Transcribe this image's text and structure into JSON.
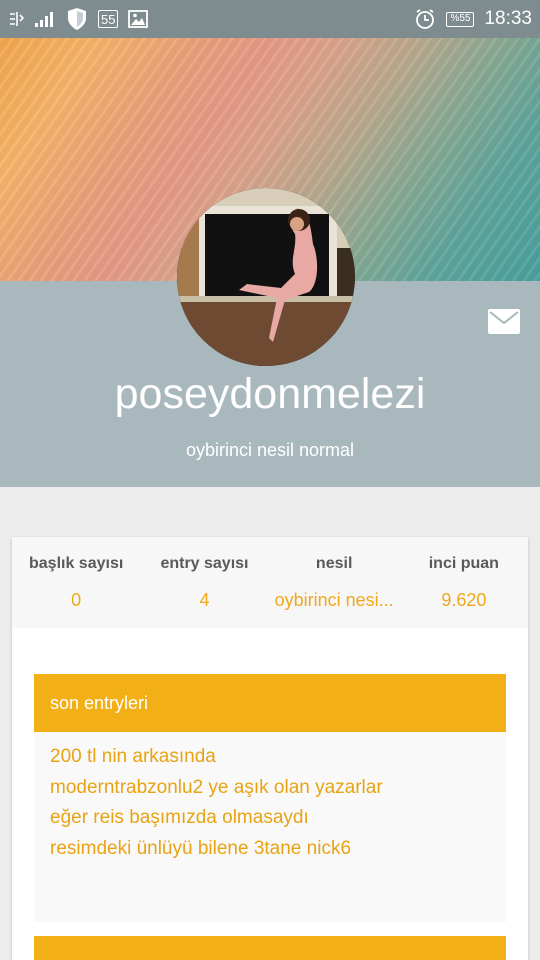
{
  "status_bar": {
    "left_icons": [
      "usb-debug-icon",
      "signal-icon",
      "shield-icon",
      "notification-count-icon",
      "image-icon"
    ],
    "notification_count": "55",
    "battery_label": "%55",
    "time": "18:33"
  },
  "profile": {
    "username": "poseydonmelezi",
    "subtitle": "oybirinci nesil normal"
  },
  "stats": [
    {
      "label": "başlık sayısı",
      "value": "0"
    },
    {
      "label": "entry sayısı",
      "value": "4"
    },
    {
      "label": "nesil",
      "value": "oybirinci nesi..."
    },
    {
      "label": "inci puan",
      "value": "9.620"
    }
  ],
  "sections": {
    "recent_entries": {
      "title": "son entryleri",
      "items": [
        "200 tl nin arkasında",
        "moderntrabzonlu2 ye aşık olan yazarlar",
        "eğer reis başımızda olmasaydı",
        "resimdeki ünlüyü bilene 3tane nick6"
      ]
    }
  },
  "colors": {
    "accent": "#f3b016",
    "accent_text": "#e8a315",
    "profile_bg": "#a9b8bd",
    "status_bar": "#7f8c8f"
  }
}
